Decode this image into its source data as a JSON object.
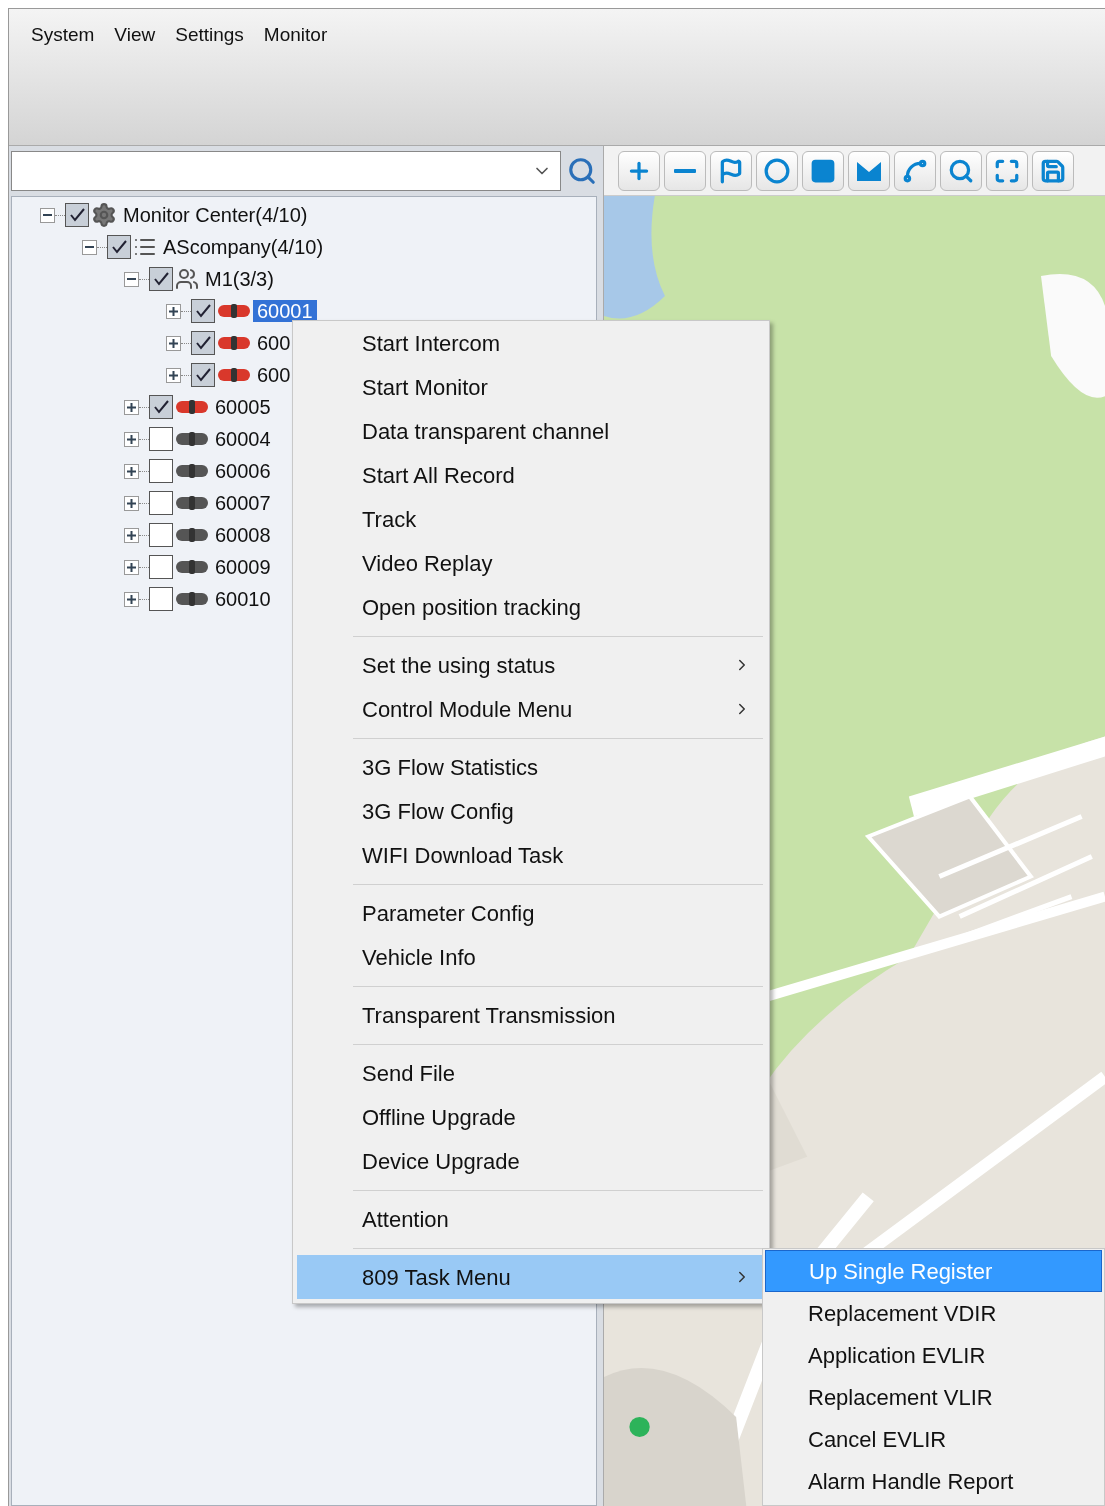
{
  "menu_bar": [
    "System",
    "View",
    "Settings",
    "Monitor"
  ],
  "tree": [
    {
      "label": "Monitor Center(4/10)",
      "kind": "center",
      "checked": true,
      "expanded": true,
      "selected": false,
      "children": [
        {
          "label": "AScompany(4/10)",
          "kind": "company",
          "checked": true,
          "expanded": true,
          "selected": false,
          "children": [
            {
              "label": "M1(3/3)",
              "kind": "group",
              "checked": true,
              "expanded": true,
              "selected": false,
              "children": [
                {
                  "label": "60001",
                  "kind": "vehicle",
                  "online": true,
                  "checked": true,
                  "expanded": false,
                  "selected": true
                },
                {
                  "label": "600",
                  "kind": "vehicle",
                  "online": true,
                  "checked": true,
                  "expanded": false,
                  "selected": false
                },
                {
                  "label": "600",
                  "kind": "vehicle",
                  "online": true,
                  "checked": true,
                  "expanded": false,
                  "selected": false
                }
              ]
            },
            {
              "label": "60005",
              "kind": "vehicle",
              "online": true,
              "checked": true,
              "expanded": false,
              "selected": false
            },
            {
              "label": "60004",
              "kind": "vehicle",
              "online": false,
              "checked": false,
              "expanded": false,
              "selected": false
            },
            {
              "label": "60006",
              "kind": "vehicle",
              "online": false,
              "checked": false,
              "expanded": false,
              "selected": false
            },
            {
              "label": "60007",
              "kind": "vehicle",
              "online": false,
              "checked": false,
              "expanded": false,
              "selected": false
            },
            {
              "label": "60008",
              "kind": "vehicle",
              "online": false,
              "checked": false,
              "expanded": false,
              "selected": false
            },
            {
              "label": "60009",
              "kind": "vehicle",
              "online": false,
              "checked": false,
              "expanded": false,
              "selected": false
            },
            {
              "label": "60010",
              "kind": "vehicle",
              "online": false,
              "checked": false,
              "expanded": false,
              "selected": false
            }
          ]
        }
      ]
    }
  ],
  "map_toolbar": [
    {
      "kind": "zoom-in"
    },
    {
      "kind": "zoom-out"
    },
    {
      "kind": "flag"
    },
    {
      "kind": "circle"
    },
    {
      "kind": "rectangle"
    },
    {
      "kind": "polygon"
    },
    {
      "kind": "line"
    },
    {
      "kind": "search"
    },
    {
      "kind": "fit"
    },
    {
      "kind": "save"
    }
  ],
  "context_menu": {
    "groups": [
      [
        {
          "label": "Start Intercom",
          "submenu": false,
          "selected": false
        },
        {
          "label": "Start Monitor",
          "submenu": false,
          "selected": false
        },
        {
          "label": "Data transparent channel",
          "submenu": false,
          "selected": false
        },
        {
          "label": "Start All Record",
          "submenu": false,
          "selected": false
        },
        {
          "label": "Track",
          "submenu": false,
          "selected": false
        },
        {
          "label": "Video Replay",
          "submenu": false,
          "selected": false
        },
        {
          "label": "Open position tracking",
          "submenu": false,
          "selected": false
        }
      ],
      [
        {
          "label": "Set the using status",
          "submenu": true,
          "selected": false
        },
        {
          "label": "Control Module Menu",
          "submenu": true,
          "selected": false
        }
      ],
      [
        {
          "label": "3G Flow Statistics",
          "submenu": false,
          "selected": false
        },
        {
          "label": "3G Flow Config",
          "submenu": false,
          "selected": false
        },
        {
          "label": "WIFI Download Task",
          "submenu": false,
          "selected": false
        }
      ],
      [
        {
          "label": "Parameter Config",
          "submenu": false,
          "selected": false
        },
        {
          "label": "Vehicle Info",
          "submenu": false,
          "selected": false
        }
      ],
      [
        {
          "label": "Transparent Transmission",
          "submenu": false,
          "selected": false
        }
      ],
      [
        {
          "label": "Send File",
          "submenu": false,
          "selected": false
        },
        {
          "label": "Offline Upgrade",
          "submenu": false,
          "selected": false
        },
        {
          "label": "Device Upgrade",
          "submenu": false,
          "selected": false
        }
      ],
      [
        {
          "label": "Attention",
          "submenu": false,
          "selected": false
        }
      ],
      [
        {
          "label": "809 Task Menu",
          "submenu": true,
          "selected": true
        }
      ]
    ]
  },
  "submenu": [
    {
      "label": "Up Single Register",
      "selected": true
    },
    {
      "label": "Replacement VDIR",
      "selected": false
    },
    {
      "label": "Application EVLIR",
      "selected": false
    },
    {
      "label": "Replacement VLIR",
      "selected": false
    },
    {
      "label": "Cancel EVLIR",
      "selected": false
    },
    {
      "label": "Alarm Handle Report",
      "selected": false
    }
  ]
}
